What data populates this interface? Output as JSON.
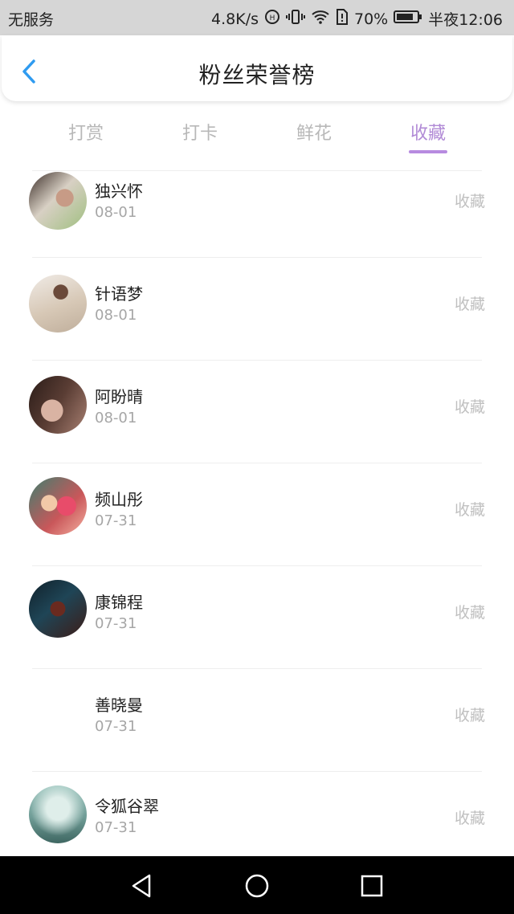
{
  "status": {
    "carrier": "无服务",
    "speed": "4.8K/s",
    "battery": "70%",
    "time": "半夜12:06"
  },
  "header": {
    "title": "粉丝荣誉榜"
  },
  "tabs": [
    {
      "label": "打赏"
    },
    {
      "label": "打卡"
    },
    {
      "label": "鲜花"
    },
    {
      "label": "收藏"
    }
  ],
  "accent_color": "#b18ad6",
  "list": [
    {
      "name": "独兴怀",
      "date": "08-01",
      "action": "收藏"
    },
    {
      "name": "针语梦",
      "date": "08-01",
      "action": "收藏"
    },
    {
      "name": "阿盼晴",
      "date": "08-01",
      "action": "收藏"
    },
    {
      "name": "频山彤",
      "date": "07-31",
      "action": "收藏"
    },
    {
      "name": "康锦程",
      "date": "07-31",
      "action": "收藏"
    },
    {
      "name": "善晓曼",
      "date": "07-31",
      "action": "收藏"
    },
    {
      "name": "令狐谷翠",
      "date": "07-31",
      "action": "收藏"
    }
  ]
}
